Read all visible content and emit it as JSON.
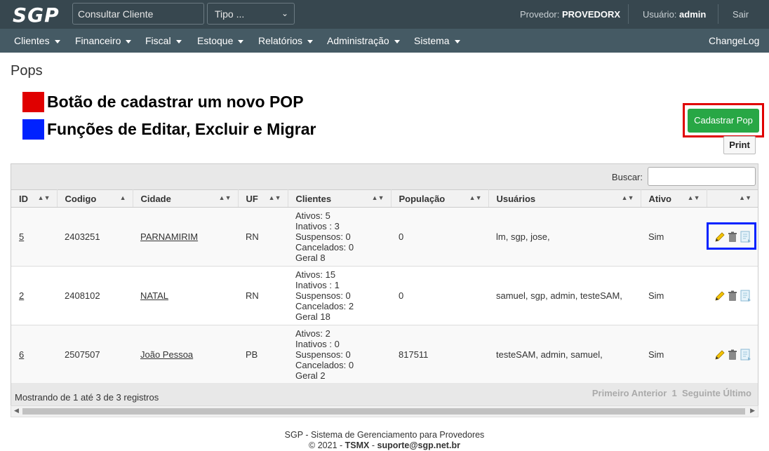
{
  "top": {
    "logo": "SGP",
    "search_placeholder": "Consultar Cliente",
    "tipo_select": "Tipo ...",
    "provedor_label": "Provedor:",
    "provedor_value": "PROVEDORX",
    "usuario_label": "Usuário:",
    "usuario_value": "admin",
    "sair": "Sair"
  },
  "menu": {
    "items": [
      "Clientes",
      "Financeiro",
      "Fiscal",
      "Estoque",
      "Relatórios",
      "Administração",
      "Sistema"
    ],
    "changelog": "ChangeLog"
  },
  "page": {
    "title": "Pops",
    "legend_red": "Botão de cadastrar um novo POP",
    "legend_blue": "Funções de Editar, Excluir e Migrar",
    "cadastrar_btn": "Cadastrar Pop",
    "print_btn": "Print"
  },
  "table": {
    "buscar_label": "Buscar:",
    "columns": [
      "ID",
      "Codigo",
      "Cidade",
      "UF",
      "Clientes",
      "População",
      "Usuários",
      "Ativo",
      ""
    ],
    "rows": [
      {
        "id": "5",
        "codigo": "2403251",
        "cidade": "PARNAMIRIM",
        "uf": "RN",
        "clientes": [
          "Ativos: 5",
          "Inativos : 3",
          "Suspensos: 0",
          "Cancelados: 0",
          "Geral 8"
        ],
        "populacao": "0",
        "usuarios": "lm, sgp, jose,",
        "ativo": "Sim"
      },
      {
        "id": "2",
        "codigo": "2408102",
        "cidade": "NATAL",
        "uf": "RN",
        "clientes": [
          "Ativos: 15",
          "Inativos : 1",
          "Suspensos: 0",
          "Cancelados: 2",
          "Geral 18"
        ],
        "populacao": "0",
        "usuarios": "samuel, sgp, admin, testeSAM,",
        "ativo": "Sim"
      },
      {
        "id": "6",
        "codigo": "2507507",
        "cidade": "João Pessoa",
        "uf": "PB",
        "clientes": [
          "Ativos: 2",
          "Inativos : 0",
          "Suspensos: 0",
          "Cancelados: 0",
          "Geral 2"
        ],
        "populacao": "817511",
        "usuarios": "testeSAM, admin, samuel,",
        "ativo": "Sim"
      }
    ],
    "info": "Mostrando de 1 até 3 de 3 registros",
    "pagination": {
      "first": "Primeiro",
      "prev": "Anterior",
      "page": "1",
      "next": "Seguinte",
      "last": "Último"
    }
  },
  "footer": {
    "line1": "SGP - Sistema de Gerenciamento para Provedores",
    "line2_prefix": "© 2021 - ",
    "line2_brand": "TSMX",
    "line2_sep": " - ",
    "line2_email": "suporte@sgp.net.br"
  },
  "colors": {
    "legend_red": "#e00000",
    "legend_blue": "#0022ff",
    "primary_green": "#28a745",
    "topbar": "#37474f",
    "menubar": "#455a64"
  }
}
